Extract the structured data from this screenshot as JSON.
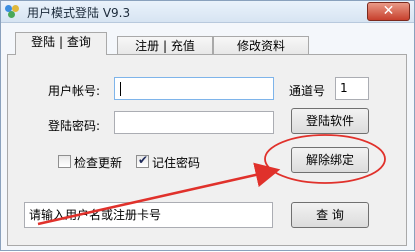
{
  "window": {
    "title": "用户模式登陆 V9.3",
    "close_glyph": "✕"
  },
  "tabs": [
    {
      "label": "登陆 | 查询",
      "active": true
    },
    {
      "label": "注册 | 充值",
      "active": false
    },
    {
      "label": "修改资料",
      "active": false
    }
  ],
  "login": {
    "account_label": "用户帐号:",
    "account_value": "",
    "password_label": "登陆密码:",
    "password_value": "",
    "channel_label": "通道号",
    "channel_value": "1",
    "login_button": "登陆软件",
    "check_update_label": "检查更新",
    "check_update_checked": false,
    "remember_password_label": "记住密码",
    "remember_password_checked": true,
    "unbind_button": "解除绑定"
  },
  "footer": {
    "status_text": "请输入用户名或注册卡号",
    "query_button": "查 询"
  },
  "annotation": {
    "color": "#e0312b"
  },
  "colors": {
    "accent_border": "#7eb4ea",
    "annotation": "#e0312b"
  }
}
